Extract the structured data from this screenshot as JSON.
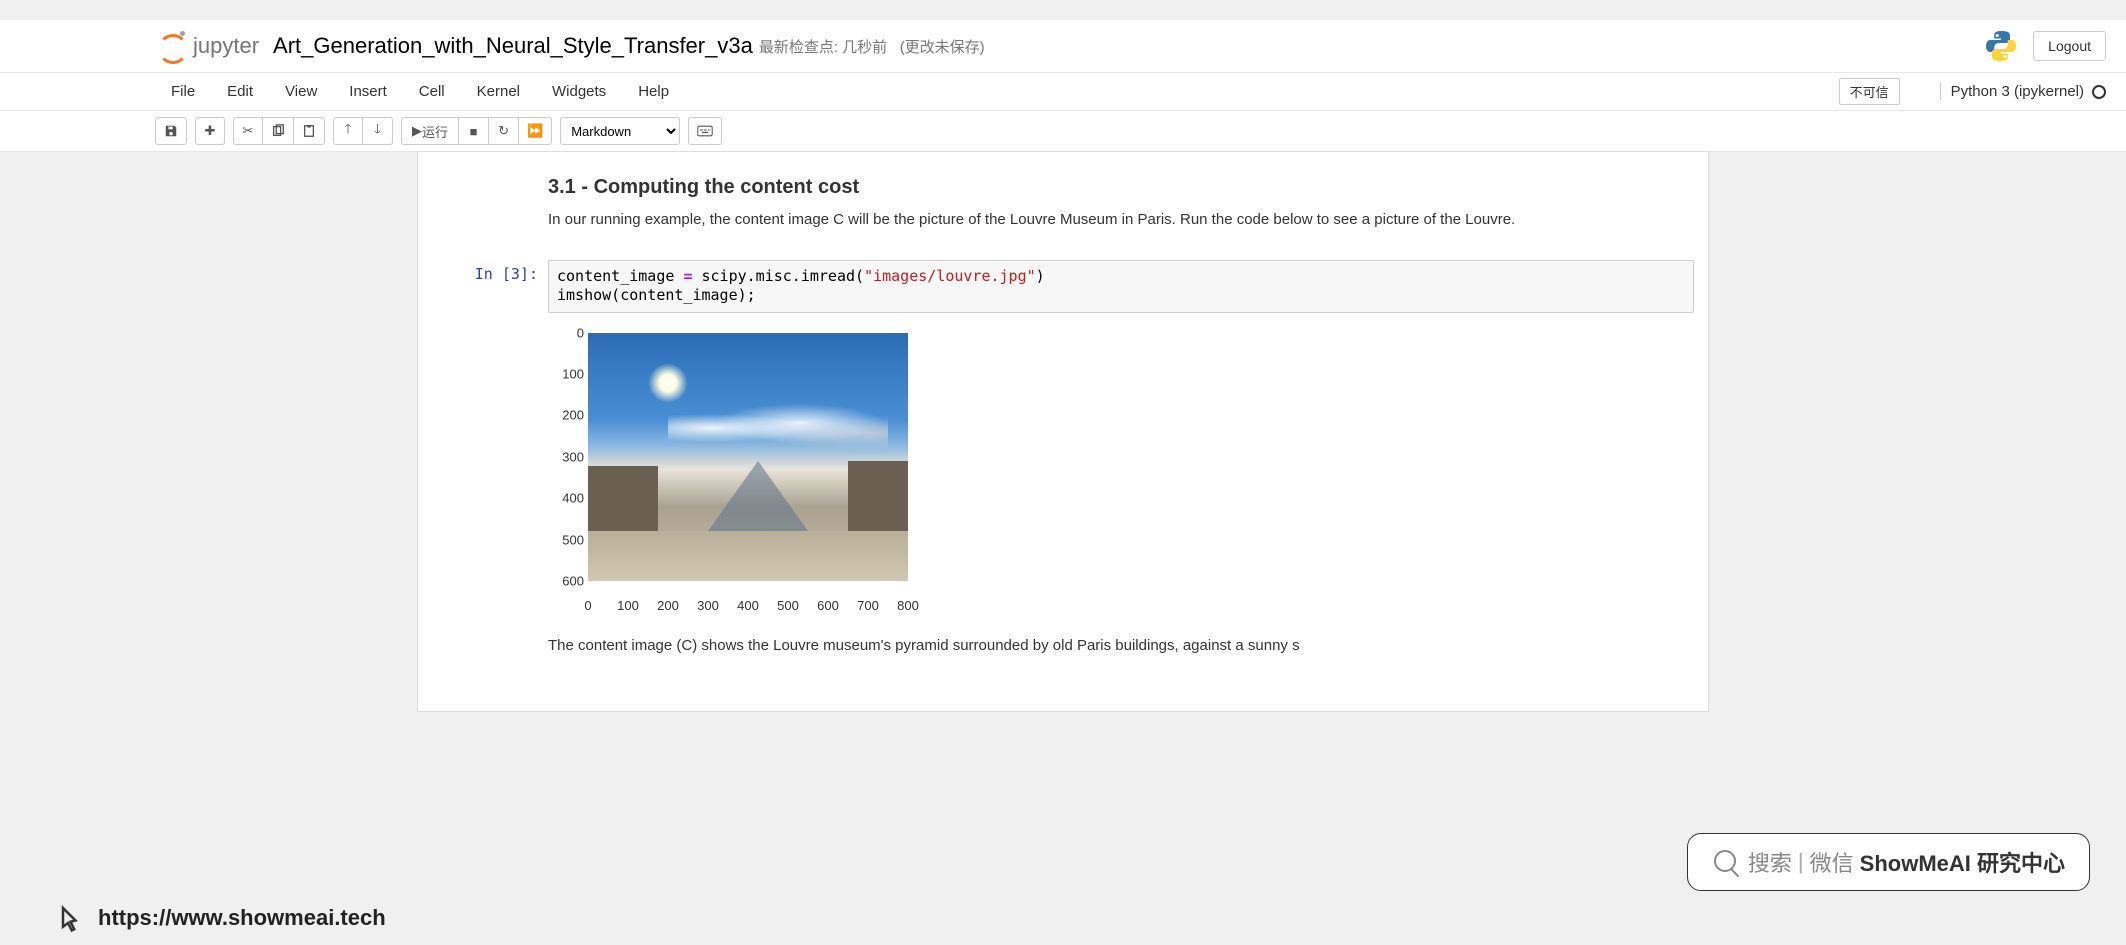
{
  "header": {
    "logo_text": "jupyter",
    "notebook_title": "Art_Generation_with_Neural_Style_Transfer_v3a",
    "checkpoint": "最新检查点: 几秒前",
    "autosave": "(更改未保存)",
    "logout": "Logout"
  },
  "menubar": {
    "items": [
      "File",
      "Edit",
      "View",
      "Insert",
      "Cell",
      "Kernel",
      "Widgets",
      "Help"
    ],
    "trust": "不可信",
    "kernel": "Python 3 (ipykernel)"
  },
  "toolbar": {
    "run_label": "运行",
    "cell_type": "Markdown"
  },
  "content": {
    "heading": "3.1 - Computing the content cost",
    "para1": "In our running example, the content image C will be the picture of the Louvre Museum in Paris. Run the code below to see a picture of the Louvre.",
    "para2": "The content image (C) shows the Louvre museum's pyramid surrounded by old Paris buildings, against a sunny s"
  },
  "code": {
    "prompt": "In  [3]:",
    "line1_a": "content_image ",
    "line1_op": "=",
    "line1_b": " scipy.misc.imread(",
    "line1_str": "\"images/louvre.jpg\"",
    "line1_c": ")",
    "line2": "imshow(content_image);"
  },
  "chart_data": {
    "type": "image-plot",
    "y_ticks": [
      0,
      100,
      200,
      300,
      400,
      500,
      600
    ],
    "x_ticks": [
      0,
      100,
      200,
      300,
      400,
      500,
      600,
      700,
      800
    ],
    "xlim": [
      0,
      800
    ],
    "ylim": [
      0,
      600
    ],
    "description": "Photo of the Louvre pyramid with sky, sun, clouds and surrounding buildings"
  },
  "watermark": {
    "search": "搜索",
    "wechat": "微信",
    "brand": "ShowMeAI 研究中心"
  },
  "footer": {
    "url": "https://www.showmeai.tech"
  }
}
